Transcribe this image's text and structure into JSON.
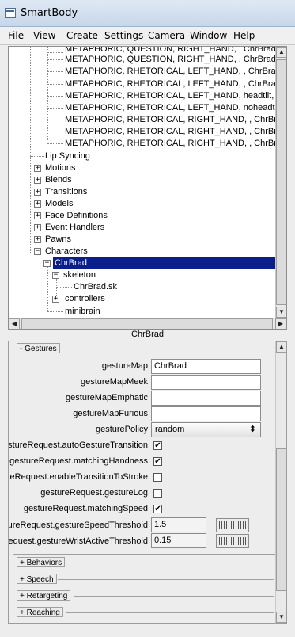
{
  "window": {
    "title": "SmartBody"
  },
  "menu": [
    "File",
    "View",
    "Create",
    "Settings",
    "Camera",
    "Window",
    "Help"
  ],
  "tree": {
    "gesture_rows": [
      "METAPHORIC, QUESTION, RIGHT_HAND, , ChrBrad@Idl",
      "METAPHORIC, QUESTION, RIGHT_HAND, , ChrBrad@Idl",
      "METAPHORIC, RHETORICAL, LEFT_HAND, , ChrBrad@Id",
      "METAPHORIC, RHETORICAL, LEFT_HAND, , ChrBrad@Id",
      "METAPHORIC, RHETORICAL, LEFT_HAND, headtilt, ChrB",
      "METAPHORIC, RHETORICAL, LEFT_HAND, noheadtilt, Ch",
      "METAPHORIC, RHETORICAL, RIGHT_HAND, , ChrBrad@",
      "METAPHORIC, RHETORICAL, RIGHT_HAND, , ChrBrad@",
      "METAPHORIC, RHETORICAL, RIGHT_HAND, , ChrBrad@"
    ],
    "lip_syncing": "Lip Syncing",
    "categories": [
      "Motions",
      "Blends",
      "Transitions",
      "Models",
      "Face Definitions",
      "Event Handlers",
      "Pawns"
    ],
    "characters": "Characters",
    "character": "ChrBrad",
    "skeleton": "skeleton",
    "skeleton_file": "ChrBrad.sk",
    "controllers": "controllers",
    "minibrain": "minibrain",
    "expand_symbol": "+",
    "collapse_symbol": "−"
  },
  "selected_label": "ChrBrad",
  "gestures": {
    "header": "- Gestures",
    "fields": [
      {
        "label": "gestureMap",
        "value": "ChrBrad"
      },
      {
        "label": "gestureMapMeek",
        "value": ""
      },
      {
        "label": "gestureMapEmphatic",
        "value": ""
      },
      {
        "label": "gestureMapFurious",
        "value": ""
      }
    ],
    "policy": {
      "label": "gesturePolicy",
      "value": "random"
    },
    "checks": [
      {
        "label": "gestureRequest.autoGestureTransition",
        "checked": true
      },
      {
        "label": "gestureRequest.matchingHandness",
        "checked": true
      },
      {
        "label": "gestureRequest.enableTransitionToStroke",
        "checked": false
      },
      {
        "label": "gestureRequest.gestureLog",
        "checked": false
      },
      {
        "label": "gestureRequest.matchingSpeed",
        "checked": true
      }
    ],
    "numbers": [
      {
        "label": "gestureRequest.gestureSpeedThreshold",
        "value": "1.5"
      },
      {
        "label": "gestureRequest.gestureWristActiveThreshold",
        "value": "0.15"
      }
    ]
  },
  "collapsed_sections": [
    "+ Behaviors",
    "+ Speech",
    "+ Retargeting",
    "+ Reaching"
  ],
  "icons": {
    "check": "✔",
    "scroll_up": "▲",
    "scroll_down": "▼",
    "scroll_left": "◀",
    "scroll_right": "▶",
    "spin": "⬍"
  }
}
